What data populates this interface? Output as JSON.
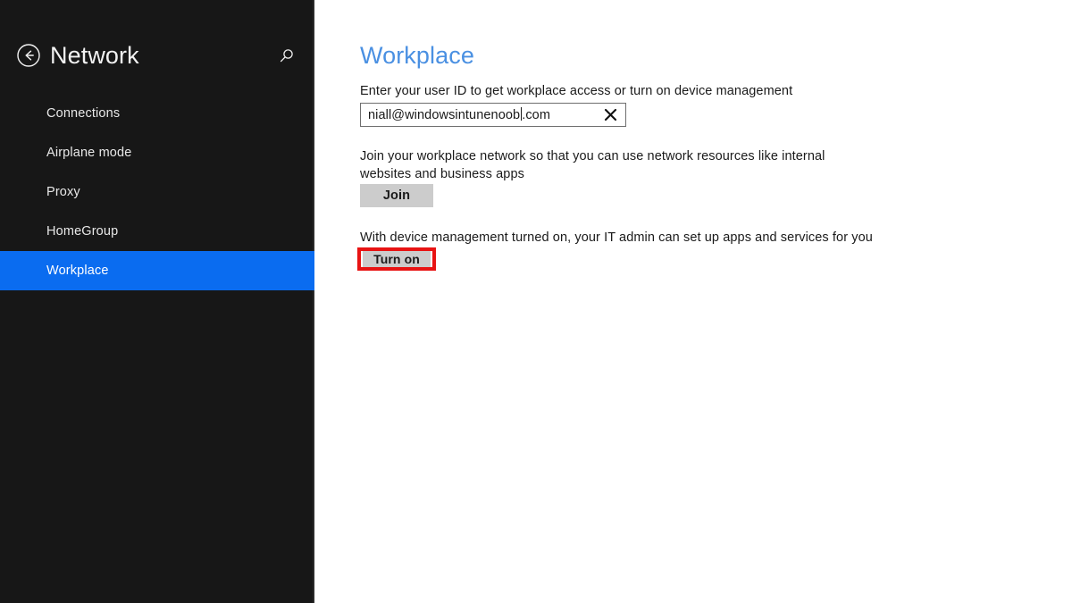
{
  "sidebar": {
    "back_icon": "back-arrow-circle-icon",
    "title": "Network",
    "search_icon": "search-icon",
    "items": [
      {
        "label": "Connections",
        "selected": false
      },
      {
        "label": "Airplane mode",
        "selected": false
      },
      {
        "label": "Proxy",
        "selected": false
      },
      {
        "label": "HomeGroup",
        "selected": false
      },
      {
        "label": "Workplace",
        "selected": true
      }
    ],
    "colors": {
      "background": "#171717",
      "selected_background": "#0a6cf0",
      "text": "#e8e8e8"
    }
  },
  "main": {
    "page_title": "Workplace",
    "userid": {
      "label": "Enter your user ID to get workplace access or turn on device management",
      "value": "niall@windowsintunenoob.com",
      "value_before_caret": "niall@windowsintunenoob",
      "value_after_caret": ".com",
      "clear_icon": "close-x-icon"
    },
    "join": {
      "description": "Join your workplace network so that you can use network resources like internal websites and business apps",
      "button_label": "Join"
    },
    "device_management": {
      "description": "With device management turned on, your IT admin can set up apps and services for you",
      "button_label": "Turn on",
      "highlighted": true,
      "highlight_color": "#e81313"
    },
    "colors": {
      "title": "#4a90e2",
      "body_text": "#1a1a1a",
      "button_background": "#cccccc"
    }
  }
}
